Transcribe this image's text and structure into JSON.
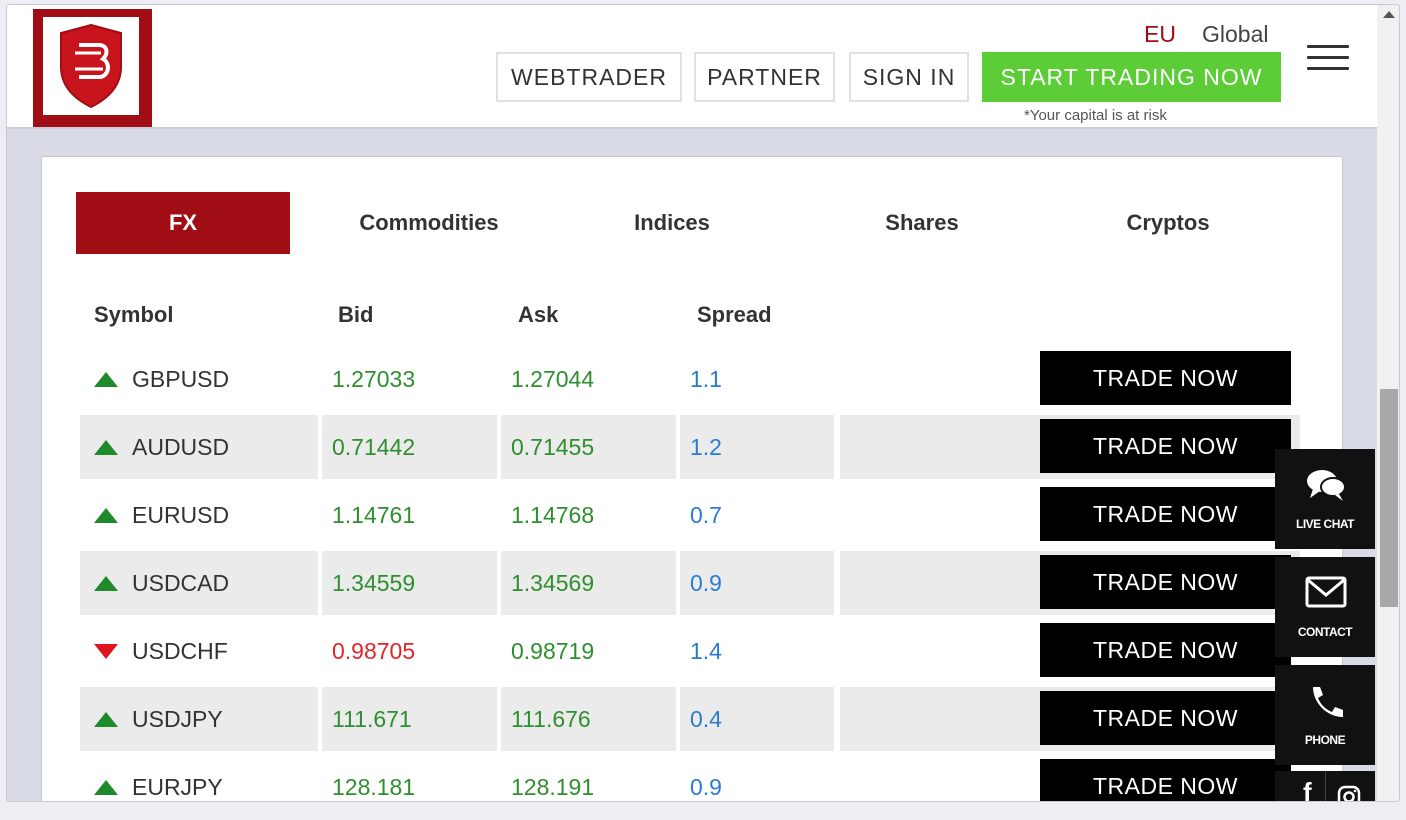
{
  "header": {
    "region_eu": "EU",
    "region_global": "Global",
    "buttons": {
      "webtrader": "WEBTRADER",
      "partner": "PARTNER",
      "signin": "SIGN IN",
      "start": "START TRADING NOW"
    },
    "capital_note": "*Your capital is at risk",
    "logo_icon": "brand-shield-logo",
    "menu_icon": "hamburger-icon"
  },
  "tabs": [
    {
      "label": "FX",
      "active": true
    },
    {
      "label": "Commodities",
      "active": false
    },
    {
      "label": "Indices",
      "active": false
    },
    {
      "label": "Shares",
      "active": false
    },
    {
      "label": "Cryptos",
      "active": false
    }
  ],
  "table": {
    "headers": [
      "Symbol",
      "Bid",
      "Ask",
      "Spread"
    ],
    "trade_label": "TRADE NOW",
    "rows": [
      {
        "symbol": "GBPUSD",
        "direction": "up",
        "bid": "1.27033",
        "ask": "1.27044",
        "spread": "1.1"
      },
      {
        "symbol": "AUDUSD",
        "direction": "up",
        "bid": "0.71442",
        "ask": "0.71455",
        "spread": "1.2"
      },
      {
        "symbol": "EURUSD",
        "direction": "up",
        "bid": "1.14761",
        "ask": "1.14768",
        "spread": "0.7"
      },
      {
        "symbol": "USDCAD",
        "direction": "up",
        "bid": "1.34559",
        "ask": "1.34569",
        "spread": "0.9"
      },
      {
        "symbol": "USDCHF",
        "direction": "down",
        "bid": "0.98705",
        "ask": "0.98719",
        "spread": "1.4"
      },
      {
        "symbol": "USDJPY",
        "direction": "up",
        "bid": "111.671",
        "ask": "111.676",
        "spread": "0.4"
      },
      {
        "symbol": "EURJPY",
        "direction": "up",
        "bid": "128.181",
        "ask": "128.191",
        "spread": "0.9"
      }
    ]
  },
  "side_widgets": {
    "live_chat": "LIVE CHAT",
    "contact": "CONTACT",
    "phone": "PHONE"
  },
  "colors": {
    "brand": "#a10d14",
    "start_button": "#5ccd36",
    "up": "#2f8f2f",
    "down": "#e0262b",
    "spread": "#2b7cd1"
  }
}
